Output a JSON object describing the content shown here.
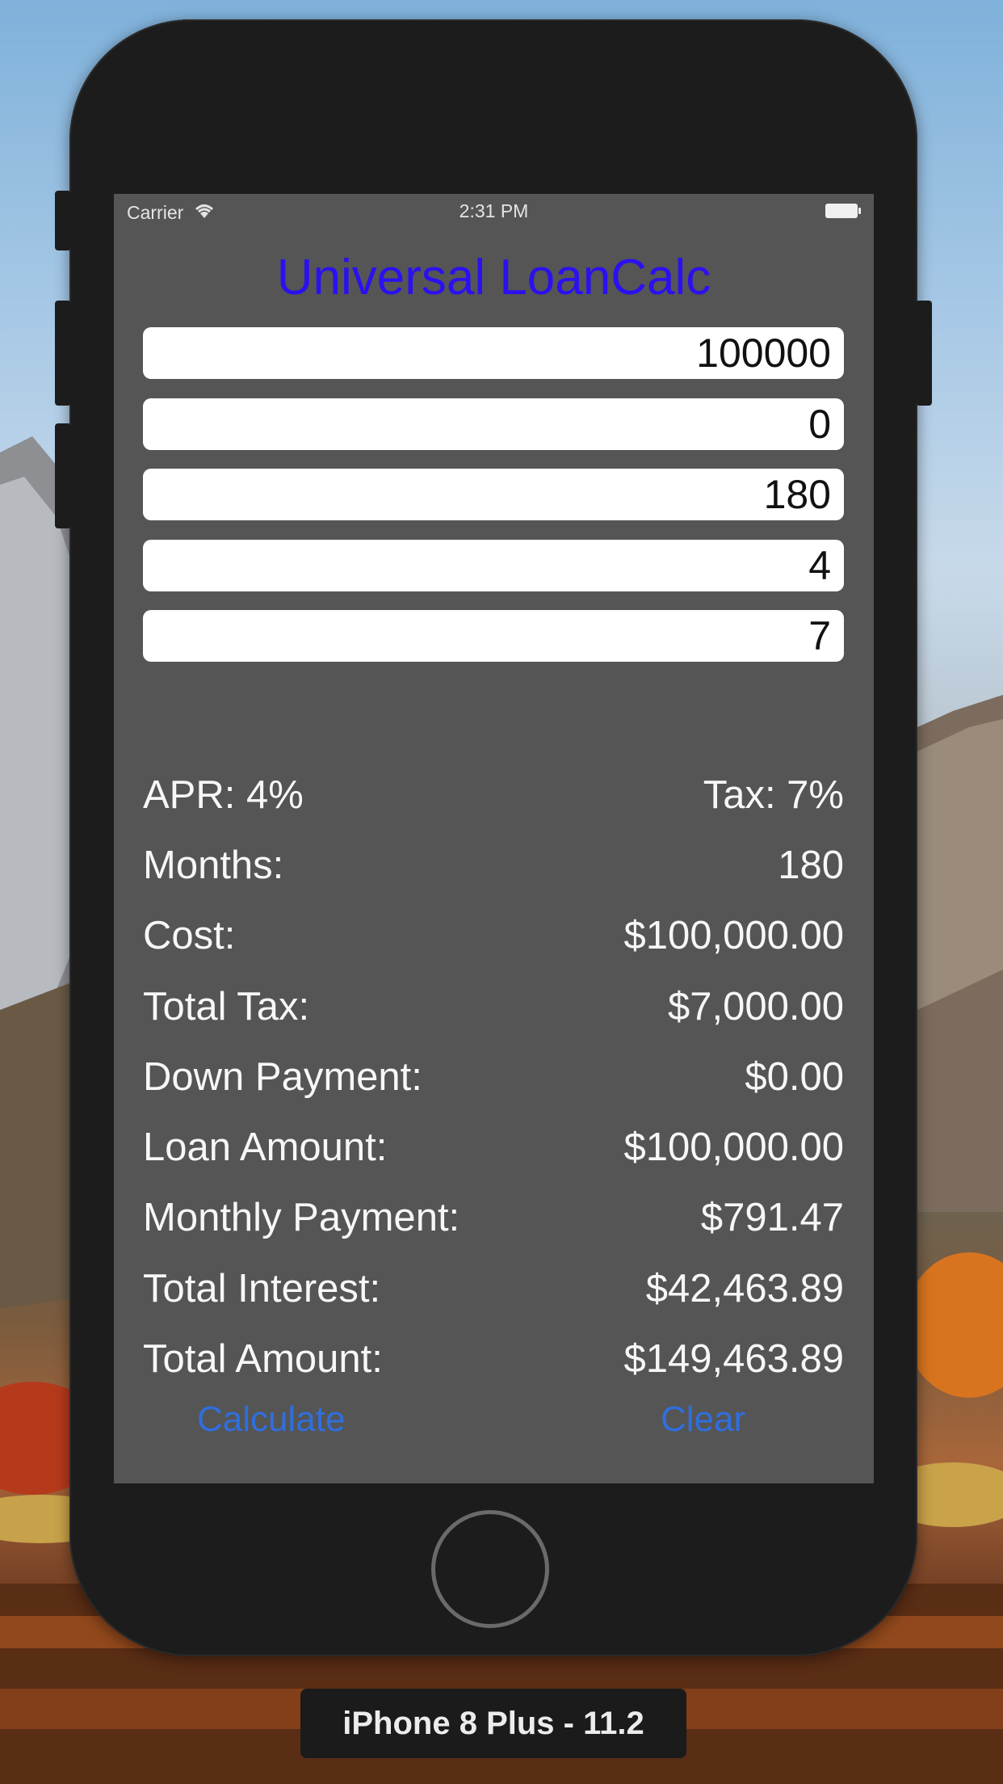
{
  "status_bar": {
    "carrier": "Carrier",
    "time": "2:31 PM",
    "wifi_icon": "wifi-icon",
    "battery_icon": "battery-icon"
  },
  "app": {
    "title": "Universal LoanCalc",
    "title_color": "#2b10f0"
  },
  "fields": [
    {
      "value": "100000"
    },
    {
      "value": "0"
    },
    {
      "value": "180"
    },
    {
      "value": "4"
    },
    {
      "value": "7"
    }
  ],
  "results": {
    "apr_label": "APR: 4%",
    "tax_label": "Tax: 7%",
    "months_label": "Months:",
    "months_value": "180",
    "cost_label": "Cost:",
    "cost_value": "$100,000.00",
    "total_tax_label": "Total Tax:",
    "total_tax_value": "$7,000.00",
    "down_payment_label": "Down Payment:",
    "down_payment_value": "$0.00",
    "loan_amount_label": "Loan Amount:",
    "loan_amount_value": "$100,000.00",
    "monthly_payment_label": "Monthly Payment:",
    "monthly_payment_value": "$791.47",
    "total_interest_label": "Total Interest:",
    "total_interest_value": "$42,463.89",
    "total_amount_label": "Total Amount:",
    "total_amount_value": "$149,463.89"
  },
  "buttons": {
    "calculate": "Calculate",
    "clear": "Clear",
    "color": "#2f6fde"
  },
  "simulator": {
    "device_label": "iPhone 8 Plus - 11.2"
  }
}
